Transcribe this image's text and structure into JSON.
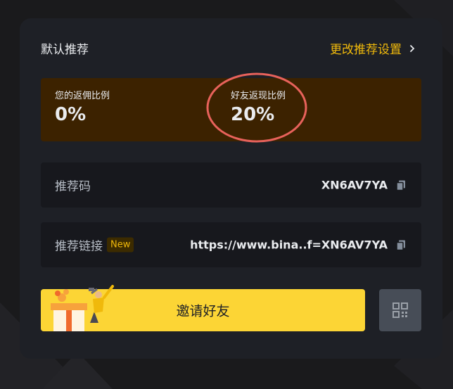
{
  "colors": {
    "accent": "#f0b90b",
    "card_bg": "#1e2026",
    "rate_panel_bg": "#3c2200",
    "button_yellow": "#fcd535",
    "annotation_red": "#e8625b"
  },
  "header": {
    "title": "默认推荐",
    "settings_link": "更改推荐设置",
    "settings_icon": "chevron-right-icon"
  },
  "rates": {
    "my_rate_label": "您的返佣比例",
    "my_rate_value": "0%",
    "friend_rate_label": "好友返现比例",
    "friend_rate_value": "20%"
  },
  "referral_code": {
    "label": "推荐码",
    "value": "XN6AV7YA",
    "icon": "copy-icon"
  },
  "referral_link": {
    "label": "推荐链接",
    "badge": "New",
    "value": "https://www.bina..f=XN6AV7YA",
    "icon": "copy-icon"
  },
  "invite_button": {
    "label": "邀请好友"
  },
  "qr_button": {
    "icon": "qr-code-icon"
  }
}
